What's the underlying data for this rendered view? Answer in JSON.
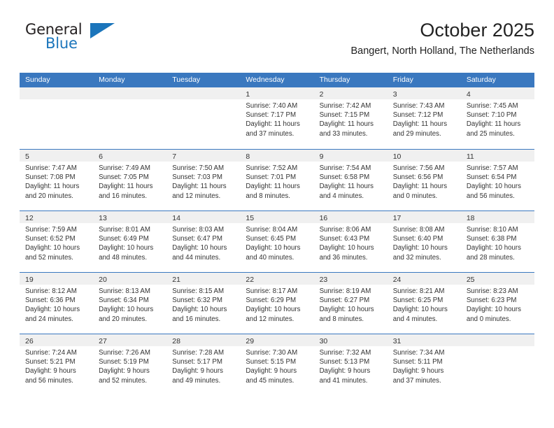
{
  "brand": {
    "name_part1": "General",
    "name_part2": "Blue",
    "triangle_icon": "brand-triangle-icon",
    "accent_color": "#1b75bb"
  },
  "header": {
    "title": "October 2025",
    "subtitle": "Bangert, North Holland, The Netherlands"
  },
  "theme": {
    "header_row_bg": "#3a78bf",
    "day_band_bg": "#f0f0f0",
    "text_color": "#333333"
  },
  "weekdays": [
    "Sunday",
    "Monday",
    "Tuesday",
    "Wednesday",
    "Thursday",
    "Friday",
    "Saturday"
  ],
  "weeks": [
    [
      {
        "day": "",
        "empty": true,
        "lines": []
      },
      {
        "day": "",
        "empty": true,
        "lines": []
      },
      {
        "day": "",
        "empty": true,
        "lines": []
      },
      {
        "day": "1",
        "empty": false,
        "lines": [
          "Sunrise: 7:40 AM",
          "Sunset: 7:17 PM",
          "Daylight: 11 hours",
          "and 37 minutes."
        ]
      },
      {
        "day": "2",
        "empty": false,
        "lines": [
          "Sunrise: 7:42 AM",
          "Sunset: 7:15 PM",
          "Daylight: 11 hours",
          "and 33 minutes."
        ]
      },
      {
        "day": "3",
        "empty": false,
        "lines": [
          "Sunrise: 7:43 AM",
          "Sunset: 7:12 PM",
          "Daylight: 11 hours",
          "and 29 minutes."
        ]
      },
      {
        "day": "4",
        "empty": false,
        "lines": [
          "Sunrise: 7:45 AM",
          "Sunset: 7:10 PM",
          "Daylight: 11 hours",
          "and 25 minutes."
        ]
      }
    ],
    [
      {
        "day": "5",
        "empty": false,
        "lines": [
          "Sunrise: 7:47 AM",
          "Sunset: 7:08 PM",
          "Daylight: 11 hours",
          "and 20 minutes."
        ]
      },
      {
        "day": "6",
        "empty": false,
        "lines": [
          "Sunrise: 7:49 AM",
          "Sunset: 7:05 PM",
          "Daylight: 11 hours",
          "and 16 minutes."
        ]
      },
      {
        "day": "7",
        "empty": false,
        "lines": [
          "Sunrise: 7:50 AM",
          "Sunset: 7:03 PM",
          "Daylight: 11 hours",
          "and 12 minutes."
        ]
      },
      {
        "day": "8",
        "empty": false,
        "lines": [
          "Sunrise: 7:52 AM",
          "Sunset: 7:01 PM",
          "Daylight: 11 hours",
          "and 8 minutes."
        ]
      },
      {
        "day": "9",
        "empty": false,
        "lines": [
          "Sunrise: 7:54 AM",
          "Sunset: 6:58 PM",
          "Daylight: 11 hours",
          "and 4 minutes."
        ]
      },
      {
        "day": "10",
        "empty": false,
        "lines": [
          "Sunrise: 7:56 AM",
          "Sunset: 6:56 PM",
          "Daylight: 11 hours",
          "and 0 minutes."
        ]
      },
      {
        "day": "11",
        "empty": false,
        "lines": [
          "Sunrise: 7:57 AM",
          "Sunset: 6:54 PM",
          "Daylight: 10 hours",
          "and 56 minutes."
        ]
      }
    ],
    [
      {
        "day": "12",
        "empty": false,
        "lines": [
          "Sunrise: 7:59 AM",
          "Sunset: 6:52 PM",
          "Daylight: 10 hours",
          "and 52 minutes."
        ]
      },
      {
        "day": "13",
        "empty": false,
        "lines": [
          "Sunrise: 8:01 AM",
          "Sunset: 6:49 PM",
          "Daylight: 10 hours",
          "and 48 minutes."
        ]
      },
      {
        "day": "14",
        "empty": false,
        "lines": [
          "Sunrise: 8:03 AM",
          "Sunset: 6:47 PM",
          "Daylight: 10 hours",
          "and 44 minutes."
        ]
      },
      {
        "day": "15",
        "empty": false,
        "lines": [
          "Sunrise: 8:04 AM",
          "Sunset: 6:45 PM",
          "Daylight: 10 hours",
          "and 40 minutes."
        ]
      },
      {
        "day": "16",
        "empty": false,
        "lines": [
          "Sunrise: 8:06 AM",
          "Sunset: 6:43 PM",
          "Daylight: 10 hours",
          "and 36 minutes."
        ]
      },
      {
        "day": "17",
        "empty": false,
        "lines": [
          "Sunrise: 8:08 AM",
          "Sunset: 6:40 PM",
          "Daylight: 10 hours",
          "and 32 minutes."
        ]
      },
      {
        "day": "18",
        "empty": false,
        "lines": [
          "Sunrise: 8:10 AM",
          "Sunset: 6:38 PM",
          "Daylight: 10 hours",
          "and 28 minutes."
        ]
      }
    ],
    [
      {
        "day": "19",
        "empty": false,
        "lines": [
          "Sunrise: 8:12 AM",
          "Sunset: 6:36 PM",
          "Daylight: 10 hours",
          "and 24 minutes."
        ]
      },
      {
        "day": "20",
        "empty": false,
        "lines": [
          "Sunrise: 8:13 AM",
          "Sunset: 6:34 PM",
          "Daylight: 10 hours",
          "and 20 minutes."
        ]
      },
      {
        "day": "21",
        "empty": false,
        "lines": [
          "Sunrise: 8:15 AM",
          "Sunset: 6:32 PM",
          "Daylight: 10 hours",
          "and 16 minutes."
        ]
      },
      {
        "day": "22",
        "empty": false,
        "lines": [
          "Sunrise: 8:17 AM",
          "Sunset: 6:29 PM",
          "Daylight: 10 hours",
          "and 12 minutes."
        ]
      },
      {
        "day": "23",
        "empty": false,
        "lines": [
          "Sunrise: 8:19 AM",
          "Sunset: 6:27 PM",
          "Daylight: 10 hours",
          "and 8 minutes."
        ]
      },
      {
        "day": "24",
        "empty": false,
        "lines": [
          "Sunrise: 8:21 AM",
          "Sunset: 6:25 PM",
          "Daylight: 10 hours",
          "and 4 minutes."
        ]
      },
      {
        "day": "25",
        "empty": false,
        "lines": [
          "Sunrise: 8:23 AM",
          "Sunset: 6:23 PM",
          "Daylight: 10 hours",
          "and 0 minutes."
        ]
      }
    ],
    [
      {
        "day": "26",
        "empty": false,
        "lines": [
          "Sunrise: 7:24 AM",
          "Sunset: 5:21 PM",
          "Daylight: 9 hours",
          "and 56 minutes."
        ]
      },
      {
        "day": "27",
        "empty": false,
        "lines": [
          "Sunrise: 7:26 AM",
          "Sunset: 5:19 PM",
          "Daylight: 9 hours",
          "and 52 minutes."
        ]
      },
      {
        "day": "28",
        "empty": false,
        "lines": [
          "Sunrise: 7:28 AM",
          "Sunset: 5:17 PM",
          "Daylight: 9 hours",
          "and 49 minutes."
        ]
      },
      {
        "day": "29",
        "empty": false,
        "lines": [
          "Sunrise: 7:30 AM",
          "Sunset: 5:15 PM",
          "Daylight: 9 hours",
          "and 45 minutes."
        ]
      },
      {
        "day": "30",
        "empty": false,
        "lines": [
          "Sunrise: 7:32 AM",
          "Sunset: 5:13 PM",
          "Daylight: 9 hours",
          "and 41 minutes."
        ]
      },
      {
        "day": "31",
        "empty": false,
        "lines": [
          "Sunrise: 7:34 AM",
          "Sunset: 5:11 PM",
          "Daylight: 9 hours",
          "and 37 minutes."
        ]
      },
      {
        "day": "",
        "empty": true,
        "lines": []
      }
    ]
  ]
}
